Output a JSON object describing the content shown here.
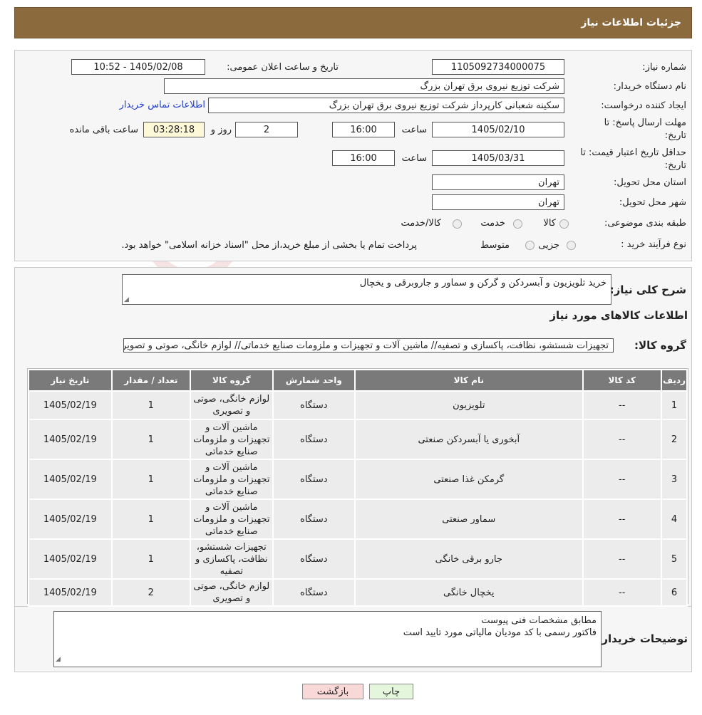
{
  "header": {
    "title": "جزئیات اطلاعات نیاز"
  },
  "form": {
    "need_number_label": "شماره نیاز:",
    "need_number": "1105092734000075",
    "announce_label": "تاریخ و ساعت اعلان عمومی:",
    "announce_value": "1405/02/08 - 10:52",
    "buyer_org_label": "نام دستگاه خریدار:",
    "buyer_org": "شرکت توزیع نیروی برق تهران بزرگ",
    "creator_label": "ایجاد کننده درخواست:",
    "creator": "سکینه شعبانی کارپرداز شرکت توزیع نیروی برق تهران بزرگ",
    "contact_link": "اطلاعات تماس خریدار",
    "deadline_label_1": "مهلت ارسال پاسخ: تا",
    "deadline_label_2": "تاریخ:",
    "deadline_date": "1405/02/10",
    "time_label": "ساعت",
    "deadline_time": "16:00",
    "days_value": "2",
    "days_label": "روز و",
    "remaining_time": "03:28:18",
    "remaining_label": "ساعت باقی مانده",
    "validity_label_1": "حداقل تاریخ اعتبار قیمت: تا",
    "validity_label_2": "تاریخ:",
    "validity_date": "1405/03/31",
    "validity_time": "16:00",
    "province_label": "استان محل تحویل:",
    "province": "تهران",
    "city_label": "شهر محل تحویل:",
    "city": "تهران",
    "category_label": "طبقه بندی موضوعی:",
    "category_options": [
      "کالا",
      "خدمت",
      "کالا/خدمت"
    ],
    "process_label": "نوع فرآیند خرید :",
    "process_options": [
      "جزیی",
      "متوسط"
    ],
    "process_note": "پرداخت تمام یا بخشی از مبلغ خرید،از محل \"اسناد خزانه اسلامی\" خواهد بود."
  },
  "details": {
    "summary_label": "شرح کلی نیاز:",
    "summary_text": "خرید تلویزیون و آبسردکن و گرکن و سماور و جاروبرقی و یخچال",
    "goods_info_title": "اطلاعات کالاهای مورد نیاز",
    "goods_group_label": "گروه کالا:",
    "goods_group_value": "تجهیزات شستشو، نظافت، پاکسازی و تصفیه// ماشین آلات و تجهیزات و ملزومات صنایع خدماتی// لوازم خانگی، صوتی و تصویری"
  },
  "table": {
    "headers": [
      "ردیف",
      "کد کالا",
      "نام کالا",
      "واحد شمارش",
      "گروه کالا",
      "تعداد / مقدار",
      "تاریخ نیاز"
    ],
    "rows": [
      [
        "1",
        "--",
        "تلویزیون",
        "دستگاه",
        "لوازم خانگی، صوتی و تصویری",
        "1",
        "1405/02/19"
      ],
      [
        "2",
        "--",
        "آبخوری یا آبسردکن صنعتی",
        "دستگاه",
        "ماشین آلات و تجهیزات و ملزومات صنایع خدماتی",
        "1",
        "1405/02/19"
      ],
      [
        "3",
        "--",
        "گرمکن غذا صنعتی",
        "دستگاه",
        "ماشین آلات و تجهیزات و ملزومات صنایع خدماتی",
        "1",
        "1405/02/19"
      ],
      [
        "4",
        "--",
        "سماور صنعتی",
        "دستگاه",
        "ماشین آلات و تجهیزات و ملزومات صنایع خدماتی",
        "1",
        "1405/02/19"
      ],
      [
        "5",
        "--",
        "جارو برقی خانگی",
        "دستگاه",
        "تجهیزات شستشو، نظافت، پاکسازی و تصفیه",
        "1",
        "1405/02/19"
      ],
      [
        "6",
        "--",
        "یخچال خانگی",
        "دستگاه",
        "لوازم خانگی، صوتی و تصویری",
        "2",
        "1405/02/19"
      ]
    ]
  },
  "buyer_notes": {
    "label": "توضیحات خریدار:",
    "line1": "مطابق مشخصات فنی پیوست",
    "line2": "فاکتور رسمی با کد مودیان مالیاتی مورد تایید است"
  },
  "buttons": {
    "print": "چاپ",
    "back": "بازگشت"
  },
  "watermark": {
    "text": "AriaTender.neT"
  },
  "colors": {
    "header_bg": "#8b6a3e",
    "table_header_bg": "#7a7a7a",
    "link": "#2440c8",
    "back_button_bg": "#f9d8d8",
    "print_button_bg": "#e4f6dc"
  }
}
